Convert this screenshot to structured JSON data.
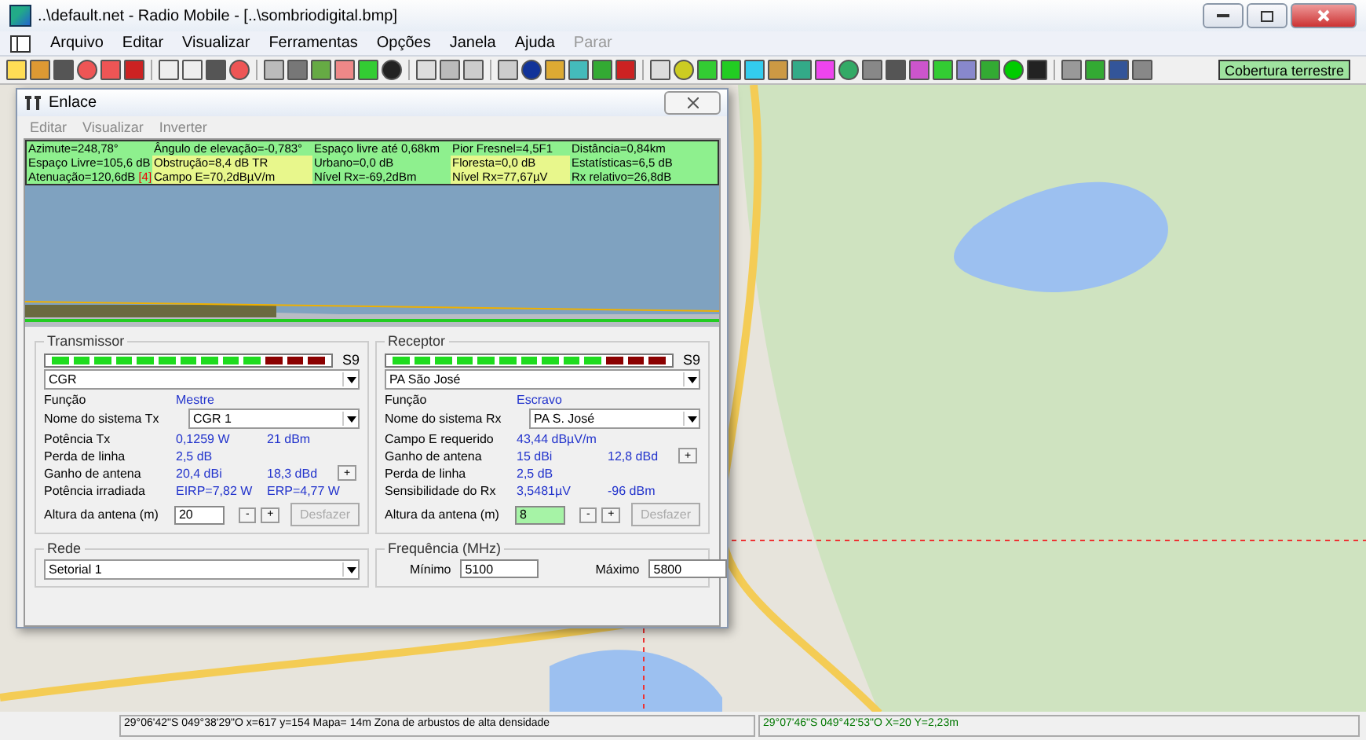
{
  "window": {
    "title": "..\\default.net - Radio Mobile - [..\\sombriodigital.bmp]"
  },
  "menu": [
    {
      "label": "Arquivo",
      "disabled": false
    },
    {
      "label": "Editar",
      "disabled": false
    },
    {
      "label": "Visualizar",
      "disabled": false
    },
    {
      "label": "Ferramentas",
      "disabled": false
    },
    {
      "label": "Opções",
      "disabled": false
    },
    {
      "label": "Janela",
      "disabled": false
    },
    {
      "label": "Ajuda",
      "disabled": false
    },
    {
      "label": "Parar",
      "disabled": true
    }
  ],
  "toolbar": {
    "coverage_button": "Cobertura terrestre"
  },
  "link_window": {
    "title": "Enlace",
    "menu": [
      "Editar",
      "Visualizar",
      "Inverter"
    ],
    "summary": [
      [
        {
          "text": "Azimute=248,78°"
        },
        {
          "text": "Ângulo de elevação=-0,783°"
        },
        {
          "text": "Espaço livre até 0,68km"
        },
        {
          "text": "Pior Fresnel=4,5F1"
        },
        {
          "text": "Distância=0,84km"
        }
      ],
      [
        {
          "text": "Espaço Livre=105,6 dB"
        },
        {
          "text": "Obstrução=8,4 dB TR"
        },
        {
          "text": "Urbano=0,0 dB"
        },
        {
          "text": "Floresta=0,0 dB"
        },
        {
          "text": "Estatísticas=6,5 dB"
        }
      ],
      [
        {
          "text": "Atenuação=120,6dB",
          "flag": "[4]"
        },
        {
          "text": "Campo E=70,2dBµV/m"
        },
        {
          "text": "Nível Rx=-69,2dBm"
        },
        {
          "text": "Nível Rx=77,67µV"
        },
        {
          "text": "Rx relativo=26,8dB"
        }
      ]
    ],
    "stations": [
      {
        "label": "Transmissor",
        "level": 0.77,
        "reading": "S9",
        "station": "CGR",
        "rows": [
          {
            "kind": "value",
            "label": "Função",
            "value": "Mestre"
          },
          {
            "kind": "select",
            "label": "Nome do sistema Tx",
            "value": "CGR 1"
          },
          {
            "kind": "value",
            "label": "Potência Tx",
            "value": "0,1259 W",
            "value2": "21 dBm"
          },
          {
            "kind": "value",
            "label": "Perda de linha",
            "value": "2,5 dB"
          },
          {
            "kind": "value",
            "label": "Ganho de antena",
            "value": "20,4 dBi",
            "value2": "18,3 dBd",
            "button": "+"
          },
          {
            "kind": "value",
            "label": "Potência irradiada",
            "value": "EIRP=7,82 W",
            "value2": "ERP=4,77 W"
          },
          {
            "kind": "spin",
            "label": "Altura da antena (m)",
            "value": "20",
            "highlighted": false,
            "minus": "-",
            "plus": "+",
            "undo": "Desfazer",
            "undo_disabled": true
          }
        ]
      },
      {
        "label": "Receptor",
        "level": 0.77,
        "reading": "S9",
        "station": "PA São José",
        "rows": [
          {
            "kind": "value",
            "label": "Função",
            "value": "Escravo"
          },
          {
            "kind": "select",
            "label": "Nome do sistema Rx",
            "value": "PA S. José"
          },
          {
            "kind": "value",
            "label": "Campo E requerido",
            "value": "43,44 dBµV/m"
          },
          {
            "kind": "value",
            "label": "Ganho de antena",
            "value": "15 dBi",
            "value2": "12,8 dBd",
            "button": "+"
          },
          {
            "kind": "value",
            "label": "Perda de linha",
            "value": "2,5 dB"
          },
          {
            "kind": "value",
            "label": "Sensibilidade do Rx",
            "value": "3,5481µV",
            "value2": "-96 dBm"
          },
          {
            "kind": "spin",
            "label": "Altura da antena (m)",
            "value": "8",
            "highlighted": true,
            "minus": "-",
            "plus": "+",
            "undo": "Desfazer",
            "undo_disabled": true
          }
        ]
      }
    ],
    "network": {
      "label": "Rede",
      "value": "Setorial 1"
    },
    "frequency": {
      "label": "Frequência (MHz)",
      "min_label": "Mínimo",
      "min": "5100",
      "max_label": "Máximo",
      "max": "5800"
    }
  },
  "status_bar": {
    "left": "29°06'42\"S  049°38'29\"O   x=617 y=154 Mapa= 14m Zona de arbustos de alta densidade",
    "right": "29°07'46\"S 049°42'53\"O  X=20 Y=2,23m"
  }
}
